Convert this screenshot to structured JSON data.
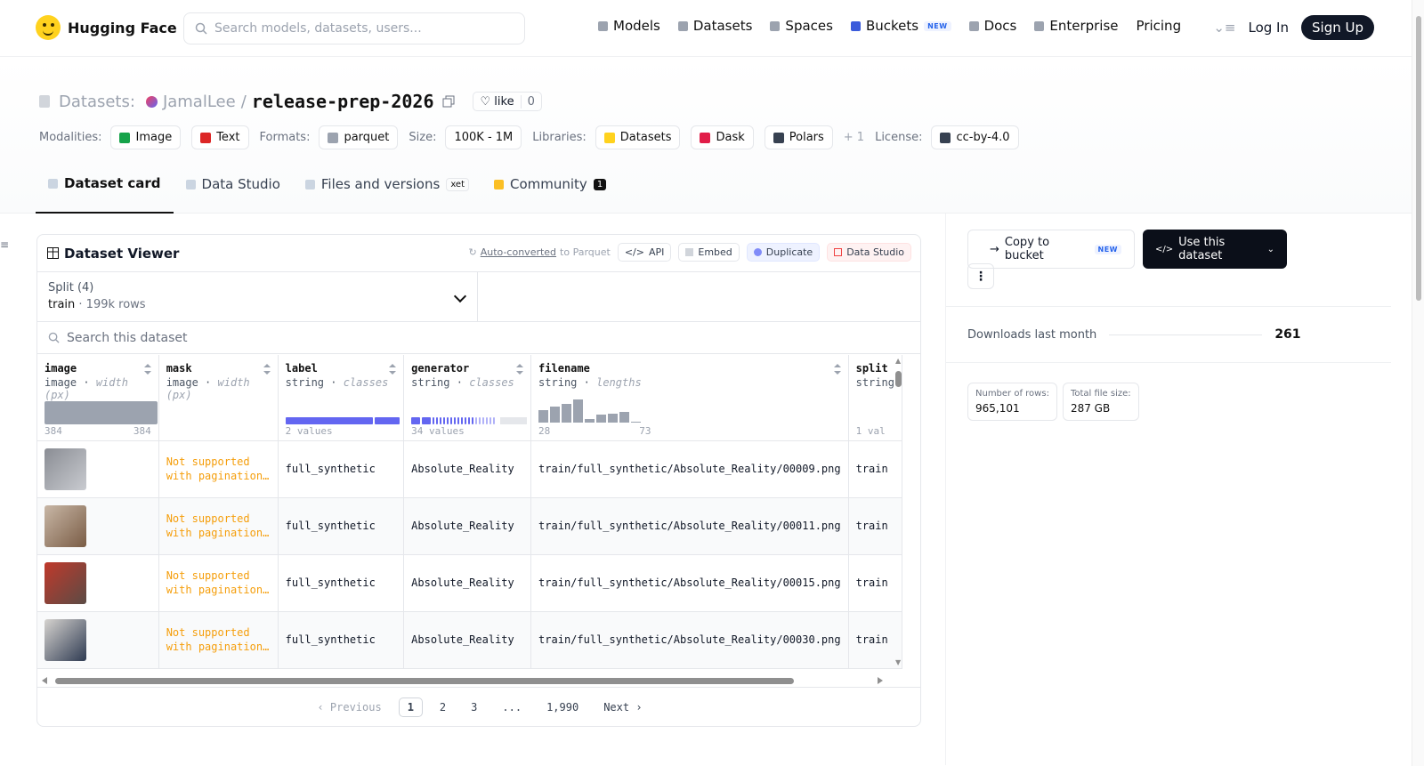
{
  "header": {
    "brand": "Hugging Face",
    "search_placeholder": "Search models, datasets, users...",
    "nav": [
      {
        "label": "Models",
        "icon": "cube-icon",
        "color": "#9ca3af"
      },
      {
        "label": "Datasets",
        "icon": "database-icon",
        "color": "#9ca3af"
      },
      {
        "label": "Spaces",
        "icon": "grid-icon",
        "color": "#9ca3af"
      },
      {
        "label": "Buckets",
        "icon": "bucket-icon",
        "color": "#3b5bdb",
        "badge": "NEW"
      },
      {
        "label": "Docs",
        "icon": "book-icon",
        "color": "#9ca3af"
      },
      {
        "label": "Enterprise",
        "icon": "enterprise-icon",
        "color": "#9ca3af"
      },
      {
        "label": "Pricing"
      }
    ],
    "login": "Log In",
    "signup": "Sign Up"
  },
  "dataset": {
    "prefix": "Datasets:",
    "owner": "JamalLee",
    "sep": "/",
    "name": "release-prep-2026",
    "like_label": "like",
    "like_count": "0",
    "meta": {
      "modalities_label": "Modalities:",
      "modalities": [
        {
          "label": "Image",
          "color": "#16a34a"
        },
        {
          "label": "Text",
          "color": "#dc2626"
        }
      ],
      "formats_label": "Formats:",
      "formats": [
        "parquet"
      ],
      "size_label": "Size:",
      "size": "100K - 1M",
      "libraries_label": "Libraries:",
      "libraries": [
        {
          "label": "Datasets",
          "color": "#ffd21e"
        },
        {
          "label": "Dask",
          "color": "#e11d48"
        },
        {
          "label": "Polars",
          "color": "#374151"
        }
      ],
      "more": "+ 1",
      "license_label": "License:",
      "license": "cc-by-4.0"
    }
  },
  "tabs": [
    {
      "label": "Dataset card",
      "active": true
    },
    {
      "label": "Data Studio"
    },
    {
      "label": "Files and versions",
      "extra": "xet"
    },
    {
      "label": "Community",
      "count": "1"
    }
  ],
  "viewer": {
    "title": "Dataset Viewer",
    "auto_converted": "Auto-converted",
    "to_parquet": "to Parquet",
    "actions": [
      "API",
      "Embed",
      "Duplicate",
      "Data Studio"
    ],
    "split_label": "Split (4)",
    "split_value": "train",
    "split_rows": "199k rows",
    "search_placeholder": "Search this dataset",
    "columns": [
      {
        "name": "image",
        "type": "image",
        "stat": "width (px)",
        "min": "384",
        "max": "384"
      },
      {
        "name": "mask",
        "type": "image",
        "stat": "width (px)"
      },
      {
        "name": "label",
        "type": "string",
        "stat": "classes",
        "summary": "2 values",
        "class_fractions": [
          0.78,
          0.22
        ]
      },
      {
        "name": "generator",
        "type": "string",
        "stat": "classes",
        "summary": "34 values"
      },
      {
        "name": "filename",
        "type": "string",
        "stat": "lengths",
        "min": "28",
        "max": "73",
        "length_hist": [
          0.55,
          0.7,
          0.8,
          1.0,
          0.15,
          0.35,
          0.4,
          0.45,
          0.05
        ]
      },
      {
        "name": "split",
        "type": "string",
        "stat": "",
        "summary": "1 val"
      }
    ],
    "rows": [
      {
        "thumb_colors": [
          "#8a8d94",
          "#c9cbd0"
        ],
        "mask": "Not supported with pagination…",
        "label": "full_synthetic",
        "generator": "Absolute_Reality",
        "filename": "train/full_synthetic/Absolute_Reality/00009.png",
        "split": "train"
      },
      {
        "thumb_colors": [
          "#c8b7a6",
          "#7a5c45"
        ],
        "mask": "Not supported with pagination…",
        "label": "full_synthetic",
        "generator": "Absolute_Reality",
        "filename": "train/full_synthetic/Absolute_Reality/00011.png",
        "split": "train"
      },
      {
        "thumb_colors": [
          "#c0392b",
          "#5b4b45"
        ],
        "mask": "Not supported with pagination…",
        "label": "full_synthetic",
        "generator": "Absolute_Reality",
        "filename": "train/full_synthetic/Absolute_Reality/00015.png",
        "split": "train"
      },
      {
        "thumb_colors": [
          "#d6d3cf",
          "#2f3b52"
        ],
        "mask": "Not supported with pagination…",
        "label": "full_synthetic",
        "generator": "Absolute_Reality",
        "filename": "train/full_synthetic/Absolute_Reality/00030.png",
        "split": "train"
      }
    ],
    "pager": {
      "prev": "Previous",
      "pages": [
        "1",
        "2",
        "3",
        "...",
        "1,990"
      ],
      "next": "Next"
    }
  },
  "sidebar": {
    "copy_bucket": "Copy to bucket",
    "copy_badge": "NEW",
    "use_dataset": "Use this dataset",
    "kebab": "⋮",
    "downloads_label": "Downloads last month",
    "downloads_value": "261",
    "stats": [
      {
        "label": "Number of rows:",
        "value": "965,101"
      },
      {
        "label": "Total file size:",
        "value": "287 GB"
      }
    ]
  }
}
